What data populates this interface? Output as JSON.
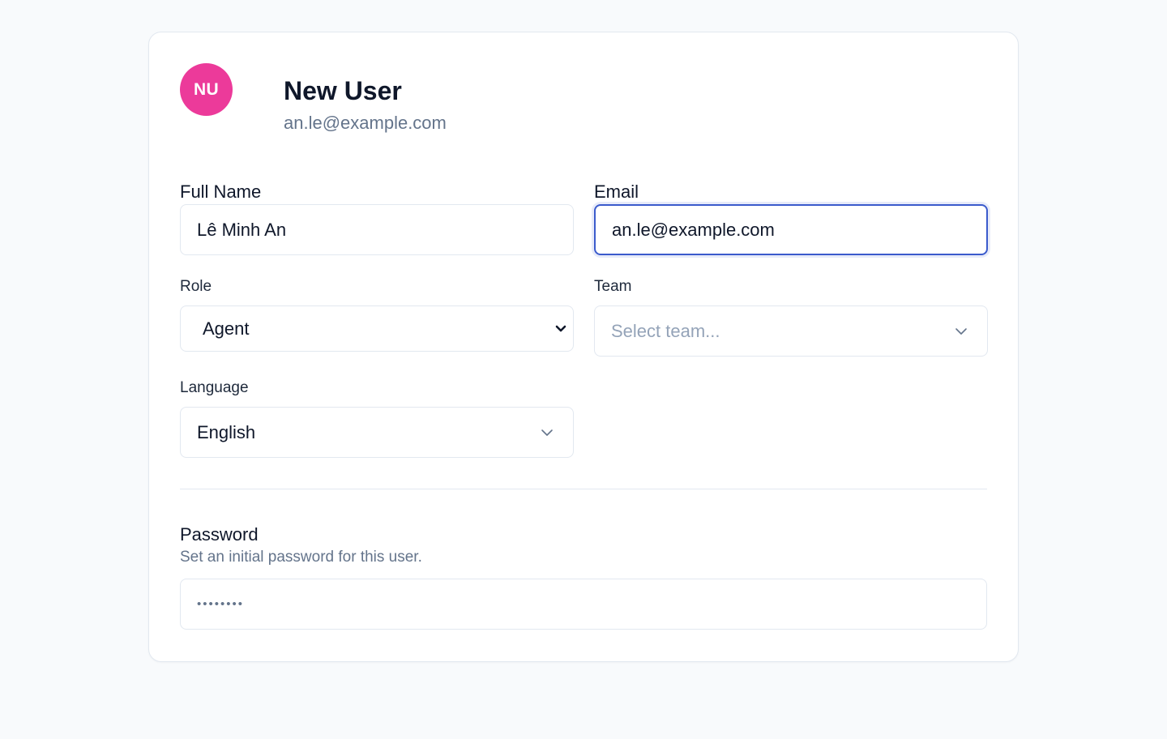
{
  "header": {
    "avatar_initials": "NU",
    "avatar_color": "#ec3a9a",
    "title": "New User",
    "subtitle": "an.le@example.com"
  },
  "form": {
    "full_name": {
      "label": "Full Name",
      "value": "Lê Minh An"
    },
    "email": {
      "label": "Email",
      "value": "an.le@example.com"
    },
    "role": {
      "label": "Role",
      "value": "Agent"
    },
    "team": {
      "label": "Team",
      "placeholder": "Select team..."
    },
    "language": {
      "label": "Language",
      "value": "English"
    }
  },
  "password": {
    "title": "Password",
    "help": "Set an initial password for this user.",
    "masked_value": "••••••••"
  },
  "icons": {
    "role_chevron": "chevron-down-icon",
    "team_chevron": "chevron-down-icon",
    "language_chevron": "chevron-down-icon"
  },
  "colors": {
    "focus_border": "#3b5bcc",
    "placeholder": "#94a3b8",
    "muted_text": "#64748b"
  }
}
